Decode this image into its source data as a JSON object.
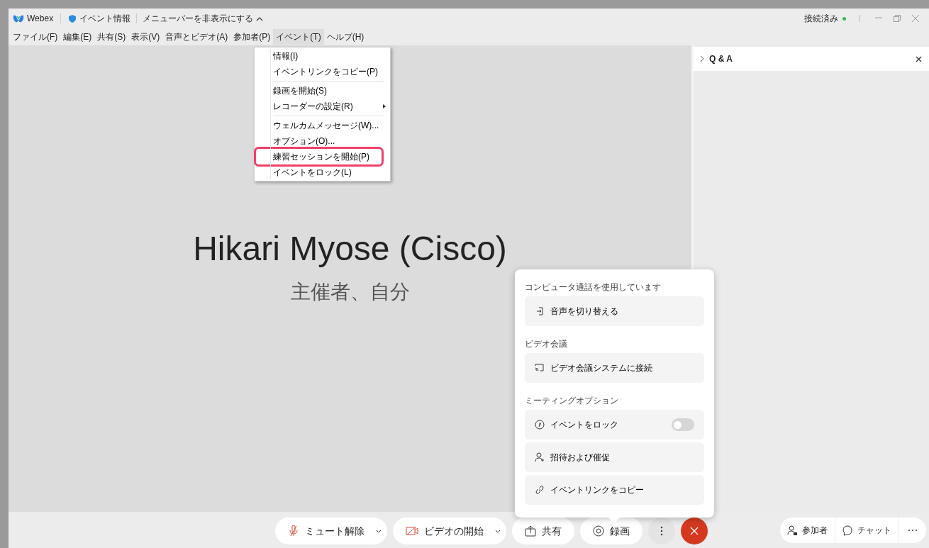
{
  "title_bar": {
    "app_name": "Webex",
    "event_info": "イベント情報",
    "hide_menu": "メニューバーを非表示にする",
    "status": "接続済み",
    "connected": true
  },
  "menu_bar": [
    {
      "label": "ファイル(F)",
      "selected": false
    },
    {
      "label": "編集(E)",
      "selected": false
    },
    {
      "label": "共有(S)",
      "selected": false
    },
    {
      "label": "表示(V)",
      "selected": false
    },
    {
      "label": "音声とビデオ(A)",
      "selected": false
    },
    {
      "label": "参加者(P)",
      "selected": false
    },
    {
      "label": "イベント(T)",
      "selected": true
    },
    {
      "label": "ヘルプ(H)",
      "selected": false
    }
  ],
  "event_menu": {
    "groups": [
      [
        {
          "label": "情報(I)",
          "submenu": false,
          "highlighted": false
        },
        {
          "label": "イベントリンクをコピー(P)",
          "submenu": false,
          "highlighted": false
        }
      ],
      [
        {
          "label": "録画を開始(S)",
          "submenu": false,
          "highlighted": false
        },
        {
          "label": "レコーダーの設定(R)",
          "submenu": true,
          "highlighted": false
        }
      ],
      [
        {
          "label": "ウェルカムメッセージ(W)...",
          "submenu": false,
          "highlighted": false
        },
        {
          "label": "オプション(O)...",
          "submenu": false,
          "highlighted": false
        },
        {
          "label": "練習セッションを開始(P)",
          "submenu": false,
          "highlighted": true
        },
        {
          "label": "イベントをロック(L)",
          "submenu": false,
          "highlighted": false
        }
      ]
    ]
  },
  "stage": {
    "name": "Hikari Myose (Cisco)",
    "role": "主催者、自分"
  },
  "qa_panel": {
    "title": "Q & A"
  },
  "more_panel": {
    "sections": [
      {
        "heading": "コンピュータ通話を使用しています",
        "items": [
          {
            "kind": "action",
            "label": "音声を切り替える"
          }
        ]
      },
      {
        "heading": "ビデオ会議",
        "items": [
          {
            "kind": "action",
            "label": "ビデオ会議システムに接続"
          }
        ]
      },
      {
        "heading": "ミーティングオプション",
        "items": [
          {
            "kind": "toggle",
            "label": "イベントをロック",
            "on": false
          },
          {
            "kind": "action",
            "label": "招待および催促"
          },
          {
            "kind": "action",
            "label": "イベントリンクをコピー"
          }
        ]
      }
    ]
  },
  "toolbar": {
    "buttons": [
      {
        "label": "ミュート解除",
        "has_menu": true
      },
      {
        "label": "ビデオの開始",
        "has_menu": true
      },
      {
        "label": "共有",
        "has_menu": false
      },
      {
        "label": "録画",
        "has_menu": false
      }
    ],
    "more_selected": true
  },
  "side_buttons": [
    {
      "label": "参加者"
    },
    {
      "label": "チャット"
    }
  ]
}
